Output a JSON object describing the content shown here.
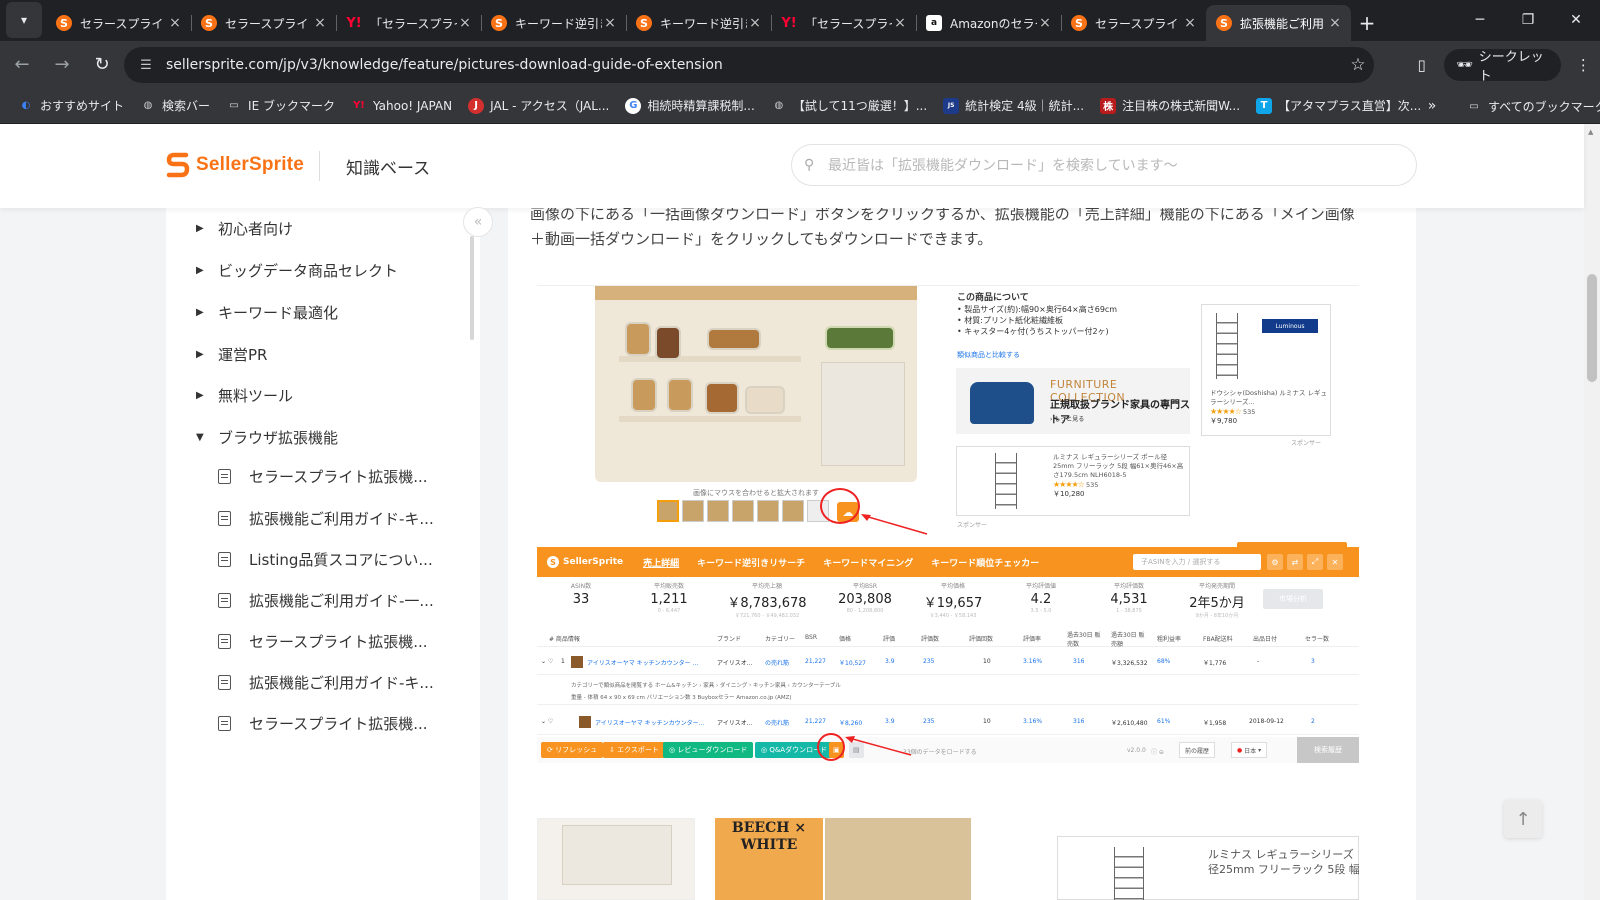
{
  "browser": {
    "tabs": [
      {
        "title": "セラースプライト",
        "icon": "sellersprite-icon"
      },
      {
        "title": "セラースプライト",
        "icon": "sellersprite-icon"
      },
      {
        "title": "「セラースプライト",
        "icon": "yahoo-icon"
      },
      {
        "title": "キーワード逆引き",
        "icon": "sellersprite-icon"
      },
      {
        "title": "キーワード逆引き",
        "icon": "sellersprite-icon"
      },
      {
        "title": "「セラースプライト",
        "icon": "yahoo-icon"
      },
      {
        "title": "Amazonのセラー",
        "icon": "amazon-icon"
      },
      {
        "title": "セラースプライト",
        "icon": "sellersprite-icon"
      },
      {
        "title": "拡張機能ご利用",
        "icon": "sellersprite-icon",
        "active": true
      }
    ],
    "url": "sellersprite.com/jp/v3/knowledge/feature/pictures-download-guide-of-extension",
    "incognito_label": "シークレット",
    "bookmarks": [
      {
        "label": "おすすめサイト",
        "icon": "edge-icon"
      },
      {
        "label": "検索バー",
        "icon": "globe-icon"
      },
      {
        "label": "IE ブックマーク",
        "icon": "folder-icon"
      },
      {
        "label": "Yahoo! JAPAN",
        "icon": "yahoo-icon"
      },
      {
        "label": "JAL - アクセス（JAL...",
        "icon": "jal-icon"
      },
      {
        "label": "相続時精算課税制...",
        "icon": "google-icon"
      },
      {
        "label": "【試して11つ厳選！】...",
        "icon": "globe-icon"
      },
      {
        "label": "統計検定 4級｜統計...",
        "icon": "jssc-icon"
      },
      {
        "label": "注目株の株式新聞W...",
        "icon": "kabushiki-icon"
      },
      {
        "label": "【アタマプラス直営】次...",
        "icon": "t-icon"
      }
    ],
    "all_bookmarks_label": "すべてのブックマーク"
  },
  "header": {
    "logo_text": "SellerSprite",
    "section_title": "知識ベース",
    "search_placeholder": "最近皆は「拡張機能ダウンロード」を検索しています〜"
  },
  "sidebar": {
    "categories": [
      {
        "label": "初心者向け",
        "expanded": false
      },
      {
        "label": "ビッグデータ商品セレクト",
        "expanded": false
      },
      {
        "label": "キーワード最適化",
        "expanded": false
      },
      {
        "label": "運営PR",
        "expanded": false
      },
      {
        "label": "無料ツール",
        "expanded": false
      },
      {
        "label": "ブラウザ拡張機能",
        "expanded": true
      }
    ],
    "articles": [
      "セラースプライト拡張機...",
      "拡張機能ご利用ガイド-キ...",
      "Listing品質スコアについ...",
      "拡張機能ご利用ガイド-一...",
      "セラースプライト拡張機...",
      "拡張機能ご利用ガイド-キ...",
      "セラースプライト拡張機..."
    ]
  },
  "article": {
    "paragraph": "画像の下にある「一括画像ダウンロード」ボタンをクリックするか、拡張機能の「売上詳細」機能の下にある「メイン画像＋動画一括ダウンロード」をクリックしてもダウンロードできます。"
  },
  "shot1": {
    "hover_note": "画像にマウスを合わせると拡大されます",
    "about_title": "この商品について",
    "about_lines": [
      "• 製品サイズ(約):幅90×奥行64×高さ69cm",
      "• 材質:プリント紙化粧繊維板",
      "• キャスター4ヶ付(うちストッパー付2ヶ)"
    ],
    "compare_link": "類似商品と比較する",
    "banner_title": "FURNITURE COLLECTION",
    "banner_subtitle": "正規取扱ブランド家具の専門ストア",
    "banner_more": "› もっと見る",
    "rack_title": "ルミナス レギュラーシリーズ ポール径25mm フリーラック 5段 幅61×奥行46×高さ179.5cm NLH6018-5",
    "rack_reviews": "535",
    "rack_price": "￥10,280",
    "ad_brand": "Luminous",
    "ad_title": "ドウシシャ(Doshisha) ルミナス レギュラーシリーズ...",
    "ad_reviews": "535",
    "ad_price": "￥9,780",
    "sponsored": "スポンサー"
  },
  "shot2": {
    "logo": "SellerSprite",
    "tabs": [
      "売上詳細",
      "キーワード逆引きリサーチ",
      "キーワードマイニング",
      "キーワード順位チェッカー"
    ],
    "asin_placeholder": "子ASINを入力 / 選択する",
    "stats": [
      {
        "label": "ASIN数",
        "value": "33",
        "sub": ""
      },
      {
        "label": "平均販売数",
        "value": "1,211",
        "sub": "0 - 6,447"
      },
      {
        "label": "平均売上額",
        "value": "￥8,783,678",
        "sub": "￥721,760 - ￥49,482,032"
      },
      {
        "label": "平均BSR",
        "value": "203,808",
        "sub": "80 - 1,208,800"
      },
      {
        "label": "平均価格",
        "value": "￥19,657",
        "sub": "￥3,440 - ￥58,143"
      },
      {
        "label": "平均評価値",
        "value": "4.2",
        "sub": "3.5 - 5.0"
      },
      {
        "label": "平均評価数",
        "value": "4,531",
        "sub": "1 - 38,875"
      },
      {
        "label": "平均発売期間",
        "value": "2年5か月",
        "sub": "9か月 - 8年10か月"
      }
    ],
    "analyze_label": "市場分析",
    "columns": [
      "# 商品情報",
      "ブランド",
      "カテゴリー",
      "BSR",
      "価格",
      "評価",
      "評価数",
      "評価回数",
      "評価率",
      "過去30日 販売数",
      "過去30日 販売額",
      "粗利益率",
      "FBA配送料",
      "出品日付",
      "セラー数"
    ],
    "rows": [
      {
        "no": "1",
        "title": "アイリスオーヤマ キッチンカウンター ...",
        "brand": "アイリスオ...",
        "category": "の売れ筋",
        "bsr": "21,227",
        "price": "￥10,527",
        "rating": "3.9",
        "reviews": "235",
        "ratings": "10",
        "rate": "3.16%",
        "sales": "316",
        "revenue": "￥3,326,532",
        "margin": "68%",
        "fba": "￥1,776",
        "date": "-",
        "sellers": "3"
      },
      {
        "no": "",
        "title": "アイリスオーヤマ キッチンカウンター...",
        "brand": "アイリスオ...",
        "category": "の売れ筋",
        "bsr": "21,227",
        "price": "￥8,260",
        "rating": "3.9",
        "reviews": "235",
        "ratings": "10",
        "rate": "3.16%",
        "sales": "316",
        "revenue": "￥2,610,480",
        "margin": "61%",
        "fba": "￥1,958",
        "date": "2018-09-12",
        "sellers": "2"
      }
    ],
    "subrow_category": "カテゴリーで類似商品を閲覧する  ホーム&キッチン › 家具 › ダイニング・キッチン家具 › カウンターテーブル",
    "subrow_detail": "重量  -   体積  64 x 90 x 69 cm   バリエーション数  3   Buyboxセラー  Amazon.co.jp (AMZ)",
    "buttons": [
      "リフレッシュ",
      "エクスポート",
      "レビューダウンロード",
      "Q&Aダウンロード"
    ],
    "footer_note": "33個のデータをロードする",
    "version": "v2.0.0",
    "history_label": "前の履歴",
    "country_label": "日本",
    "gray_btn": "検索履歴"
  },
  "shot3": {
    "beech_text": "BEECH × WHITE",
    "rack_text_1": "ルミナス レギュラーシリーズ",
    "rack_text_2": "径25mm フリーラック 5段 幅"
  },
  "colors": {
    "brand": "#f97316",
    "extension_bar": "#f7931e",
    "annotation": "#e22222"
  }
}
